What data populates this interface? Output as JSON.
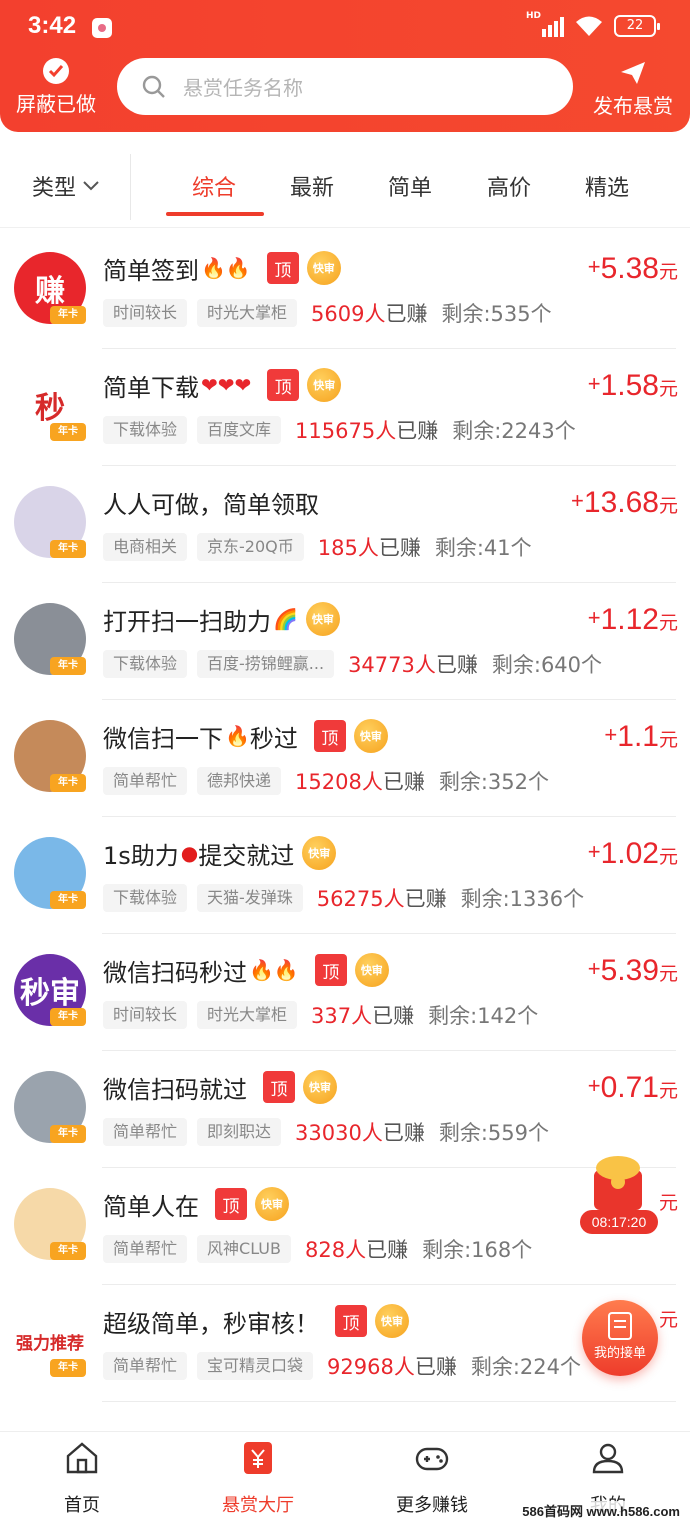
{
  "status_bar": {
    "time": "3:42",
    "battery": "22"
  },
  "header": {
    "hide_done_label": "屏蔽已做",
    "search_placeholder": "悬赏任务名称",
    "publish_label": "发布悬赏"
  },
  "filter": {
    "type_label": "类型",
    "tabs": [
      "综合",
      "最新",
      "简单",
      "高价",
      "精选"
    ],
    "active_tab": "综合"
  },
  "badges": {
    "top": "顶",
    "fast": "快审",
    "year": "年卡"
  },
  "tasks": [
    {
      "title": "简单签到",
      "emoji": "🔥🔥",
      "emoji_kind": "fire",
      "top": true,
      "fast": true,
      "price_sign": "+",
      "price": "5.38",
      "unit": "元",
      "tag1": "时间较长",
      "tag2": "时光大掌柜",
      "earned_count": "5609人",
      "earned_suffix": "已赚",
      "remain": "剩余:535个",
      "avatar_text": "赚",
      "avatar_color": "#e8262c"
    },
    {
      "title": "简单下载",
      "emoji": "❤❤❤",
      "emoji_kind": "heart",
      "top": true,
      "fast": true,
      "price_sign": "+",
      "price": "1.58",
      "unit": "元",
      "tag1": "下载体验",
      "tag2": "百度文库",
      "earned_count": "115675人",
      "earned_suffix": "已赚",
      "remain": "剩余:2243个",
      "avatar_text": "秒",
      "avatar_color": "#ffffff"
    },
    {
      "title": "人人可做，简单领取",
      "emoji": "",
      "emoji_kind": "",
      "top": false,
      "fast": false,
      "price_sign": "+",
      "price": "13.68",
      "unit": "元",
      "tag1": "电商相关",
      "tag2": "京东-20Q币",
      "earned_count": "185人",
      "earned_suffix": "已赚",
      "remain": "剩余:41个",
      "avatar_text": "",
      "avatar_color": "#d9d4e8"
    },
    {
      "title": "打开扫一扫助力",
      "emoji": "🌈",
      "emoji_kind": "rainbow",
      "top": false,
      "fast": true,
      "price_sign": "+",
      "price": "1.12",
      "unit": "元",
      "tag1": "下载体验",
      "tag2": "百度-捞锦鲤赢...",
      "earned_count": "34773人",
      "earned_suffix": "已赚",
      "remain": "剩余:640个",
      "avatar_text": "",
      "avatar_color": "#8a8f97"
    },
    {
      "title": "微信扫一下",
      "emoji": "🔥",
      "emoji_kind": "fire",
      "title_suffix": "秒过",
      "top": true,
      "fast": true,
      "price_sign": "+",
      "price": "1.1",
      "unit": "元",
      "tag1": "简单帮忙",
      "tag2": "德邦快递",
      "earned_count": "15208人",
      "earned_suffix": "已赚",
      "remain": "剩余:352个",
      "avatar_text": "",
      "avatar_color": "#c58a5a"
    },
    {
      "title": "1s助力",
      "emoji": "●",
      "emoji_kind": "red",
      "title_suffix": "提交就过",
      "top": false,
      "fast": true,
      "price_sign": "+",
      "price": "1.02",
      "unit": "元",
      "tag1": "下载体验",
      "tag2": "天猫-发弹珠",
      "earned_count": "56275人",
      "earned_suffix": "已赚",
      "remain": "剩余:1336个",
      "avatar_text": "",
      "avatar_color": "#7ab8e8"
    },
    {
      "title": "微信扫码秒过",
      "emoji": "🔥🔥",
      "emoji_kind": "fire",
      "top": true,
      "fast": true,
      "price_sign": "+",
      "price": "5.39",
      "unit": "元",
      "tag1": "时间较长",
      "tag2": "时光大掌柜",
      "earned_count": "337人",
      "earned_suffix": "已赚",
      "remain": "剩余:142个",
      "avatar_text": "秒审",
      "avatar_color": "#6a2fa8"
    },
    {
      "title": "微信扫码就过",
      "emoji": "",
      "emoji_kind": "",
      "top": true,
      "fast": true,
      "price_sign": "+",
      "price": "0.71",
      "unit": "元",
      "tag1": "简单帮忙",
      "tag2": "即刻职达",
      "earned_count": "33030人",
      "earned_suffix": "已赚",
      "remain": "剩余:559个",
      "avatar_text": "",
      "avatar_color": "#9aa3ad"
    },
    {
      "title": "简单人在",
      "emoji": "",
      "emoji_kind": "",
      "top": true,
      "fast": true,
      "price_sign": "",
      "price": "",
      "unit": "元",
      "tag1": "简单帮忙",
      "tag2": "风神CLUB",
      "earned_count": "828人",
      "earned_suffix": "已赚",
      "remain": "剩余:168个",
      "avatar_text": "",
      "avatar_color": "#f6d9a8"
    },
    {
      "title": "超级简单，秒审核！",
      "emoji": "",
      "emoji_kind": "",
      "top": true,
      "fast": true,
      "price_sign": "",
      "price": "",
      "unit": "元",
      "tag1": "简单帮忙",
      "tag2": "宝可精灵口袋",
      "earned_count": "92968人",
      "earned_suffix": "已赚",
      "remain": "剩余:224个",
      "avatar_text": "强力推荐",
      "avatar_color": "#ffffff"
    }
  ],
  "floating": {
    "timer": "08:17:20",
    "my_orders": "我的接单"
  },
  "bottom_nav": [
    {
      "label": "首页",
      "icon": "home-icon"
    },
    {
      "label": "悬赏大厅",
      "icon": "reward-hall-icon"
    },
    {
      "label": "更多赚钱",
      "icon": "gamepad-icon"
    },
    {
      "label": "我的",
      "icon": "user-icon"
    }
  ],
  "watermark": "586首码网 www.h586.com",
  "colors": {
    "brand": "#ee3c2b",
    "price": "#e8262c",
    "fast_badge": "#f6a21e"
  }
}
